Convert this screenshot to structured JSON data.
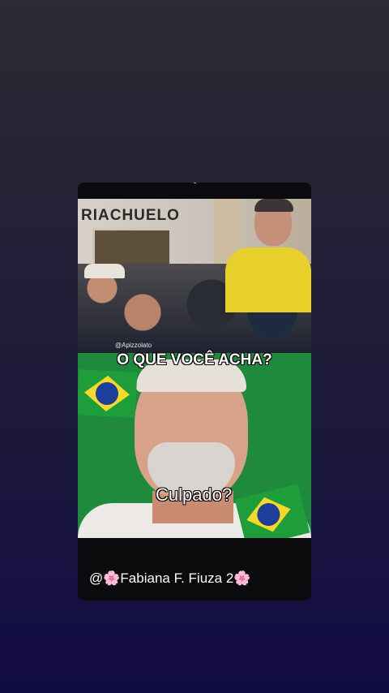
{
  "post": {
    "store_sign": "RIACHUELO",
    "watermark": "@Apizzolato",
    "question": "O QUE VOCÊ ACHA?",
    "caption": "Culpado?",
    "credit": "@🌸Fabiana F. Fiuza 2🌸"
  },
  "colors": {
    "background_top": "#2b2b33",
    "background_bottom": "#120c45",
    "flag_green": "#1e9e3a",
    "flag_yellow": "#f6d928",
    "flag_blue": "#1d3e9a"
  },
  "icons": [
    "brazil-flag-icon",
    "brazil-flag-icon"
  ]
}
